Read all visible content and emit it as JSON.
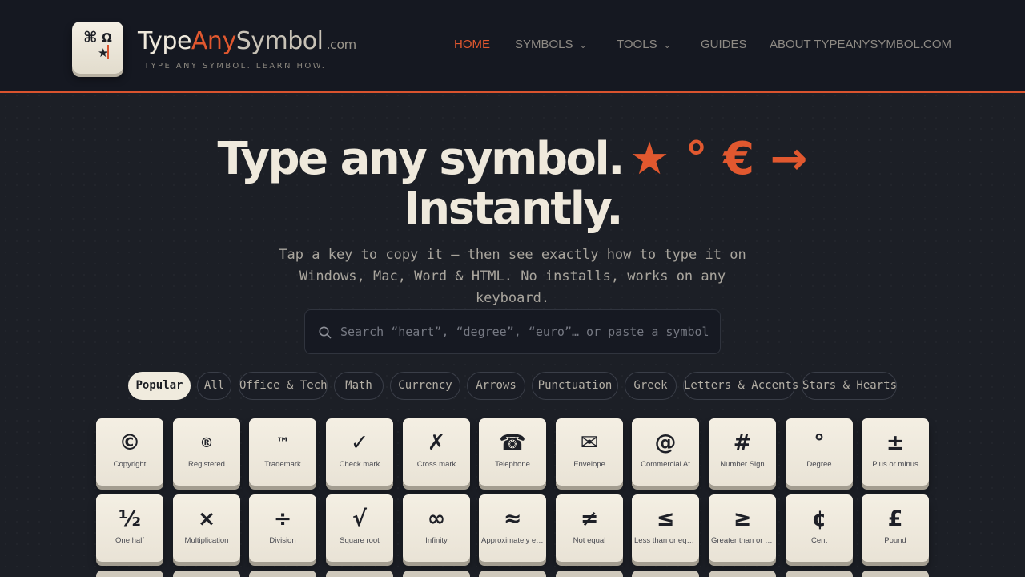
{
  "header": {
    "logo_keys": {
      "cmd": "⌘",
      "omega": "Ω",
      "star": "★"
    },
    "brand_type": "Type",
    "brand_any": "Any",
    "brand_symbol": "Symbol",
    "brand_tld": ".com",
    "tagline": "TYPE ANY SYMBOL. LEARN HOW.",
    "nav": {
      "home": "HOME",
      "symbols": "SYMBOLS",
      "tools": "TOOLS",
      "guides": "GUIDES",
      "about": "ABOUT TYPEANYSYMBOL.COM"
    }
  },
  "hero": {
    "line1": "Type any symbol.",
    "accent_symbols": "★ ° € →",
    "line2": "Instantly.",
    "subtitle": "Tap a key to copy it — then see exactly how to type it on Windows, Mac, Word & HTML. No installs, works on any keyboard."
  },
  "search": {
    "placeholder": "Search “heart”, “degree”, “euro”… or paste a symbol"
  },
  "filters": [
    "Popular",
    "All",
    "Office & Tech",
    "Math",
    "Currency",
    "Arrows",
    "Punctuation",
    "Greek",
    "Letters & Accents",
    "Stars & Hearts"
  ],
  "active_filter": "Popular",
  "keys": [
    {
      "symbol": "©",
      "label": "Copyright"
    },
    {
      "symbol": "®",
      "label": "Registered"
    },
    {
      "symbol": "™",
      "label": "Trademark"
    },
    {
      "symbol": "✓",
      "label": "Check mark"
    },
    {
      "symbol": "✗",
      "label": "Cross mark"
    },
    {
      "symbol": "☎",
      "label": "Telephone"
    },
    {
      "symbol": "✉",
      "label": "Envelope"
    },
    {
      "symbol": "@",
      "label": "Commercial At"
    },
    {
      "symbol": "#",
      "label": "Number Sign"
    },
    {
      "symbol": "°",
      "label": "Degree"
    },
    {
      "symbol": "±",
      "label": "Plus or minus"
    },
    {
      "symbol": "½",
      "label": "One half"
    },
    {
      "symbol": "×",
      "label": "Multiplication"
    },
    {
      "symbol": "÷",
      "label": "Division"
    },
    {
      "symbol": "√",
      "label": "Square root"
    },
    {
      "symbol": "∞",
      "label": "Infinity"
    },
    {
      "symbol": "≈",
      "label": "Approximately equal"
    },
    {
      "symbol": "≠",
      "label": "Not equal"
    },
    {
      "symbol": "≤",
      "label": "Less than or equal"
    },
    {
      "symbol": "≥",
      "label": "Greater than or equal"
    },
    {
      "symbol": "¢",
      "label": "Cent"
    },
    {
      "symbol": "£",
      "label": "Pound"
    }
  ],
  "colors": {
    "accent": "#e1582f",
    "background": "#1c1f26",
    "header_bg": "#151821",
    "key_face": "#f4efe3",
    "text": "#efe9dc"
  }
}
